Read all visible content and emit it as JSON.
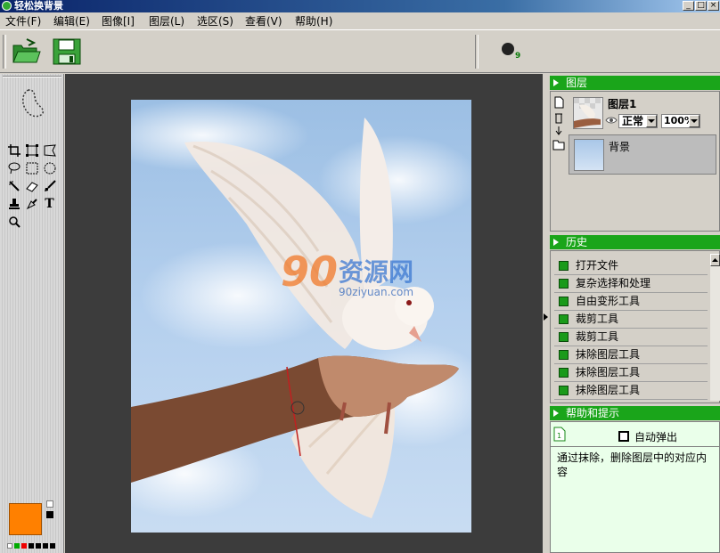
{
  "window": {
    "title": "轻松换背景"
  },
  "menu": [
    "文件(F)",
    "编辑(E)",
    "图像[I]",
    "图层(L)",
    "选区(S)",
    "查看(V)",
    "帮助(H)"
  ],
  "toolbar": {
    "brush_size": "9"
  },
  "canvas": {
    "watermark_main": "资源网",
    "watermark_digits": "90",
    "watermark_url": "90ziyuan.com"
  },
  "layers_panel": {
    "title": "图层",
    "layer1_name": "图层1",
    "blend_mode": "正常",
    "opacity": "100%",
    "background_name": "背景"
  },
  "history_panel": {
    "title": "历史",
    "items": [
      "打开文件",
      "复杂选择和处理",
      "自由变形工具",
      "裁剪工具",
      "裁剪工具",
      "抹除图层工具",
      "抹除图层工具",
      "抹除图层工具"
    ]
  },
  "help_panel": {
    "title": "帮助和提示",
    "auto_popup_label": "自动弹出",
    "text": "通过抹除，删除图层中的对应内容"
  },
  "colors": {
    "foreground": "#ff8000",
    "accent": "#1aa51a"
  }
}
